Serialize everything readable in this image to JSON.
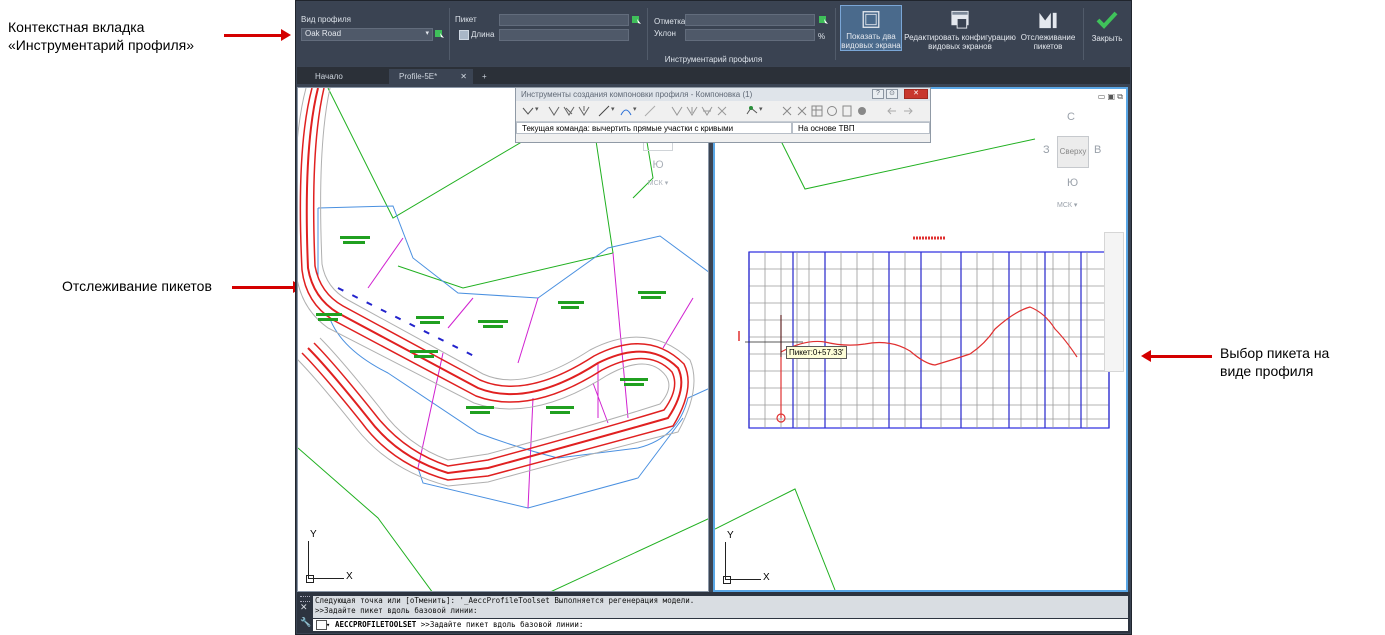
{
  "callouts": {
    "context_tab": [
      "Контекстная вкладка",
      "«Инструментарий профиля»"
    ],
    "station_tracking": "Отслеживание пикетов",
    "select_station": [
      "Выбор пикета на",
      "виде профиля"
    ]
  },
  "ribbon": {
    "profile_view_label": "Вид профиля",
    "profile_view_value": "Oak Road",
    "station_label": "Пикет",
    "length_label": "Длина",
    "elevation_label": "Отметка",
    "grade_label": "Уклон",
    "percent_sign": "%",
    "show_two_viewports": [
      "Показать два",
      "видовых экрана"
    ],
    "edit_viewport_config": [
      "Редактировать конфигурацию",
      "видовых экранов"
    ],
    "station_tracker": [
      "Отслеживание",
      "пикетов"
    ],
    "close": "Закрыть",
    "panel_title": "Инструментарий профиля"
  },
  "tabs": {
    "start": "Начало",
    "profile": "Profile-5E*",
    "add": "+"
  },
  "toolwin": {
    "title": "Инструменты создания компоновки профиля - Компоновка (1)",
    "status_command": "Текущая команда: вычертить прямые участки с кривыми",
    "status_mode": "На основе ТВП"
  },
  "viewcube_left": {
    "south": "Ю",
    "ucs": "МСК"
  },
  "viewcube_right": {
    "north": "С",
    "west": "З",
    "east": "В",
    "south": "Ю",
    "top": "Сверху",
    "ucs": "МСК"
  },
  "ucs_icon": {
    "y": "Y",
    "x": "X"
  },
  "profile": {
    "tooltip": "Пикет:0+57.33'"
  },
  "command_line": {
    "line1": "Следующая точка или [оТменить]: '_AeccProfileToolset Выполняется регенерация модели.",
    "line2": ">>Задайте пикет вдоль базовой линии:",
    "prompt_cmd": "AECCPROFILETOOLSET",
    "prompt_rest": " >>Задайте пикет вдоль базовой линии:"
  },
  "colors": {
    "ribbon_bg": "#3a4352",
    "accent_blue": "#5aa7e6",
    "road_red": "#e02020",
    "grid_blue": "#2a2ae0",
    "profile_red": "#e03030",
    "parcel_magenta": "#d020d0",
    "boundary_green": "#20b020",
    "callout_arrow": "#d40000"
  }
}
